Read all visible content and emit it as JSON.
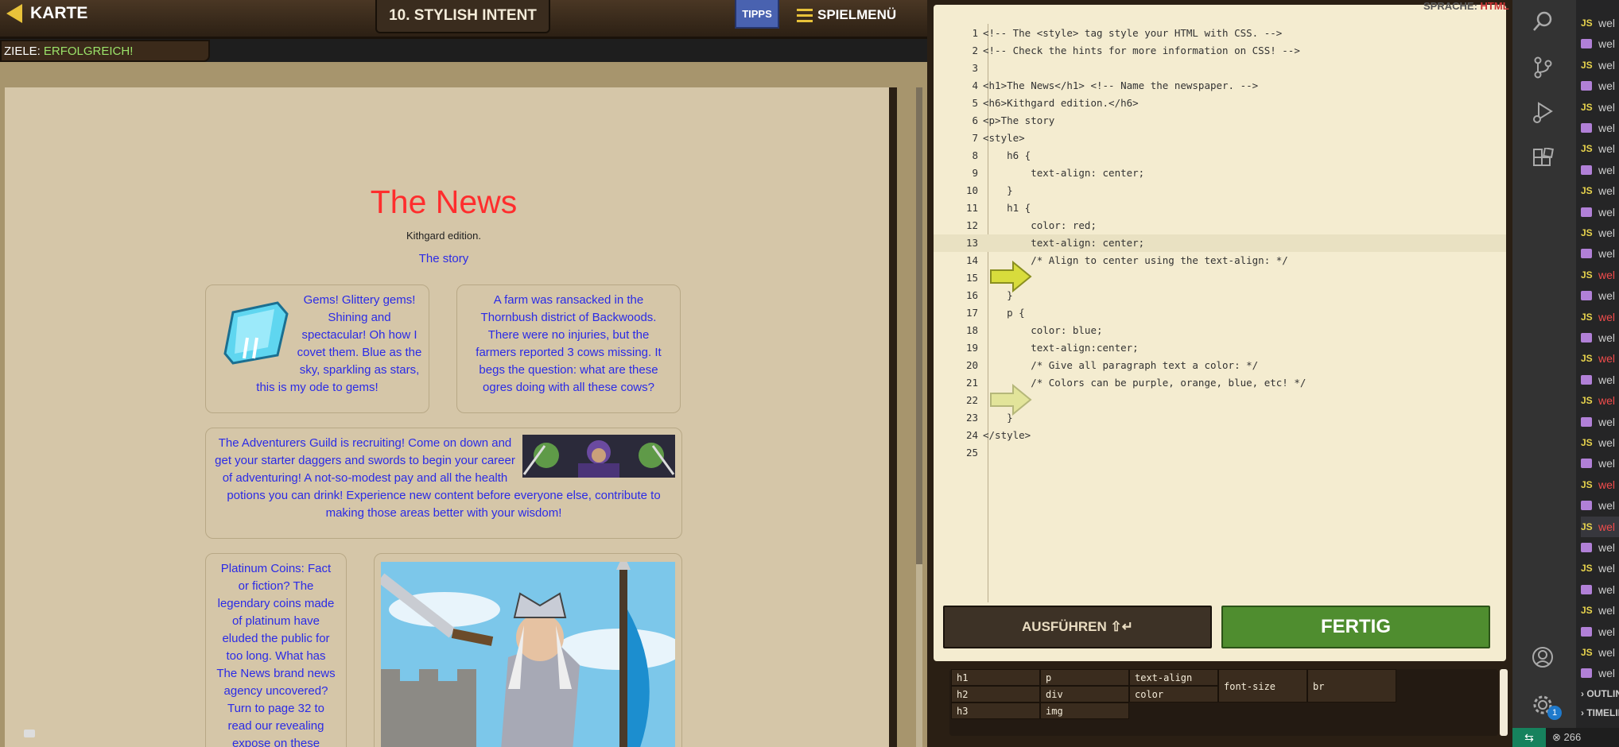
{
  "header": {
    "map_label": "KARTE",
    "goals_label": "ZIELE:",
    "goals_value": "ERFOLGREICH!",
    "level_title": "10. STYLISH INTENT",
    "hints_label": "TIPPS",
    "menu_label": "SPIELMENÜ"
  },
  "preview": {
    "title": "The News",
    "edition": "Kithgard edition.",
    "story": "The story",
    "card_gems": "Gems! Glittery gems! Shining and spectacular! Oh how I covet them. Blue as the sky, sparkling as stars, this is my ode to gems!",
    "card_farm": "A farm was ransacked in the Thornbush district of Backwoods. There were no injuries, but the farmers reported 3 cows missing. It begs the question: what are these ogres doing with all these cows?",
    "card_guild": "The Adventurers Guild is recruiting! Come on down and get your starter daggers and swords to begin your career of adventuring! A not-so-modest pay and all the health potions you can drink! Experience new content before everyone else, contribute to making those areas better with your wisdom!",
    "card_platinum": "Platinum Coins: Fact or fiction? The legendary coins made of platinum have eluded the public for too long. What has The News brand news agency uncovered? Turn to page 32 to read our revealing expose on these"
  },
  "editor": {
    "language_label": "SPRACHE:",
    "language_value": "HTML",
    "lines": [
      {
        "n": "1",
        "text": "<!-- The <style> tag style your HTML with CSS. -->"
      },
      {
        "n": "2",
        "text": "<!-- Check the hints for more information on CSS! -->"
      },
      {
        "n": "3",
        "text": ""
      },
      {
        "n": "4",
        "text": "<h1>The News</h1> <!-- Name the newspaper. -->"
      },
      {
        "n": "5",
        "text": "<h6>Kithgard edition.</h6>"
      },
      {
        "n": "6",
        "text": "<p>The story"
      },
      {
        "n": "7",
        "text": "<style>"
      },
      {
        "n": "8",
        "text": "    h6 {"
      },
      {
        "n": "9",
        "text": "        text-align: center;"
      },
      {
        "n": "10",
        "text": "    }"
      },
      {
        "n": "11",
        "text": "    h1 {"
      },
      {
        "n": "12",
        "text": "        color: red;"
      },
      {
        "n": "13",
        "text": "        text-align: center;"
      },
      {
        "n": "14",
        "text": "        /* Align to center using the text-align: */"
      },
      {
        "n": "15",
        "text": ""
      },
      {
        "n": "16",
        "text": "    }"
      },
      {
        "n": "17",
        "text": "    p {"
      },
      {
        "n": "18",
        "text": "        color: blue;"
      },
      {
        "n": "19",
        "text": "        text-align:center;"
      },
      {
        "n": "20",
        "text": "        /* Give all paragraph text a color: */"
      },
      {
        "n": "21",
        "text": "        /* Colors can be purple, orange, blue, etc! */"
      },
      {
        "n": "22",
        "text": ""
      },
      {
        "n": "23",
        "text": "    }"
      },
      {
        "n": "24",
        "text": "</style>"
      },
      {
        "n": "25",
        "text": ""
      }
    ],
    "run_label": "AUSFÜHREN ⇧↵",
    "done_label": "FERTIG",
    "palette": [
      "h1",
      "h2",
      "h3",
      "p",
      "div",
      "img",
      "text-align",
      "color",
      "font-size",
      "br"
    ]
  },
  "vscode": {
    "files": [
      {
        "kind": "js",
        "name": "wel"
      },
      {
        "kind": "video",
        "name": "wel"
      },
      {
        "kind": "js",
        "name": "wel"
      },
      {
        "kind": "video",
        "name": "wel"
      },
      {
        "kind": "js",
        "name": "wel"
      },
      {
        "kind": "video",
        "name": "wel"
      },
      {
        "kind": "js",
        "name": "wel"
      },
      {
        "kind": "video",
        "name": "wel"
      },
      {
        "kind": "js",
        "name": "wel"
      },
      {
        "kind": "video",
        "name": "wel"
      },
      {
        "kind": "js",
        "name": "wel"
      },
      {
        "kind": "video",
        "name": "wel"
      },
      {
        "kind": "js",
        "name": "wel",
        "red": true
      },
      {
        "kind": "video",
        "name": "wel"
      },
      {
        "kind": "js",
        "name": "wel",
        "red": true
      },
      {
        "kind": "video",
        "name": "wel"
      },
      {
        "kind": "js",
        "name": "wel",
        "red": true
      },
      {
        "kind": "video",
        "name": "wel"
      },
      {
        "kind": "js",
        "name": "wel",
        "red": true
      },
      {
        "kind": "video",
        "name": "wel"
      },
      {
        "kind": "js",
        "name": "wel"
      },
      {
        "kind": "video",
        "name": "wel"
      },
      {
        "kind": "js",
        "name": "wel",
        "red": true
      },
      {
        "kind": "video",
        "name": "wel"
      },
      {
        "kind": "js",
        "name": "wel",
        "red": true,
        "active": true
      },
      {
        "kind": "video",
        "name": "wel"
      },
      {
        "kind": "js",
        "name": "wel"
      },
      {
        "kind": "video",
        "name": "wel"
      },
      {
        "kind": "js",
        "name": "wel"
      },
      {
        "kind": "video",
        "name": "wel"
      },
      {
        "kind": "js",
        "name": "wel"
      },
      {
        "kind": "video",
        "name": "wel"
      }
    ],
    "outline_label": "OUTLINE",
    "timeline_label": "TIMELINE",
    "badge_count": "1",
    "status_count": "266",
    "accent": "#16825d"
  }
}
